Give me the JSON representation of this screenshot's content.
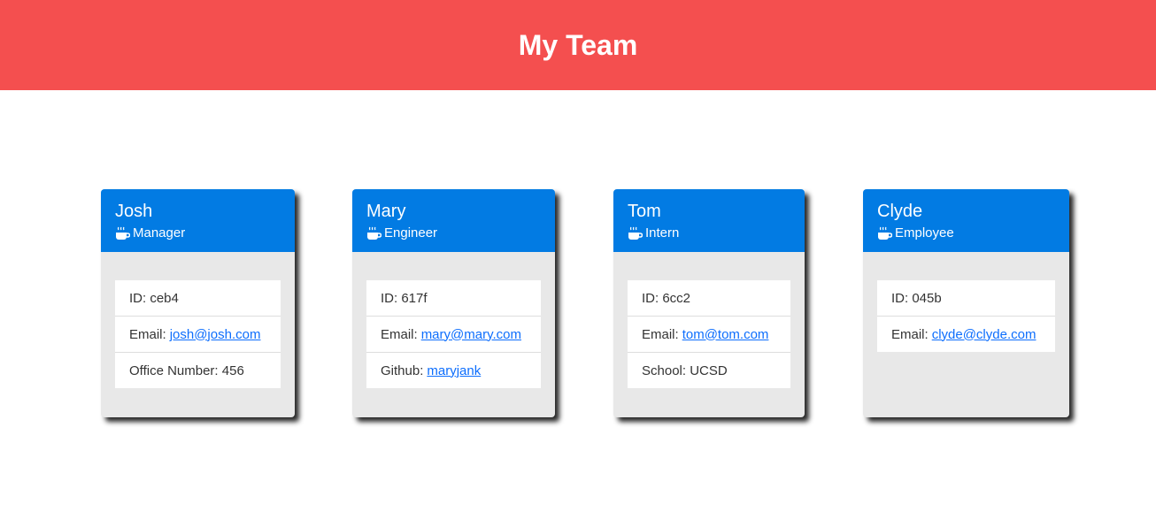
{
  "header": {
    "title": "My Team",
    "bg_color": "#f44f4f"
  },
  "card_colors": {
    "head": "#027be3",
    "body": "#e8e8e8"
  },
  "team": [
    {
      "name": "Josh",
      "role": "Manager",
      "role_icon": "coffee-cup-icon",
      "id_label": "ID: ceb4",
      "email_label": "Email:",
      "email": "josh@josh.com",
      "extra_label": "Office Number: 456",
      "extra_link": ""
    },
    {
      "name": "Mary",
      "role": "Engineer",
      "role_icon": "coffee-cup-icon",
      "id_label": "ID: 617f",
      "email_label": "Email:",
      "email": "mary@mary.com",
      "extra_label": "Github:",
      "extra_link": "maryjank"
    },
    {
      "name": "Tom",
      "role": "Intern",
      "role_icon": "coffee-cup-icon",
      "id_label": "ID: 6cc2",
      "email_label": "Email:",
      "email": "tom@tom.com",
      "extra_label": "School: UCSD",
      "extra_link": ""
    },
    {
      "name": "Clyde",
      "role": "Employee",
      "role_icon": "coffee-cup-icon",
      "id_label": "ID: 045b",
      "email_label": "Email:",
      "email": "clyde@clyde.com"
    }
  ]
}
